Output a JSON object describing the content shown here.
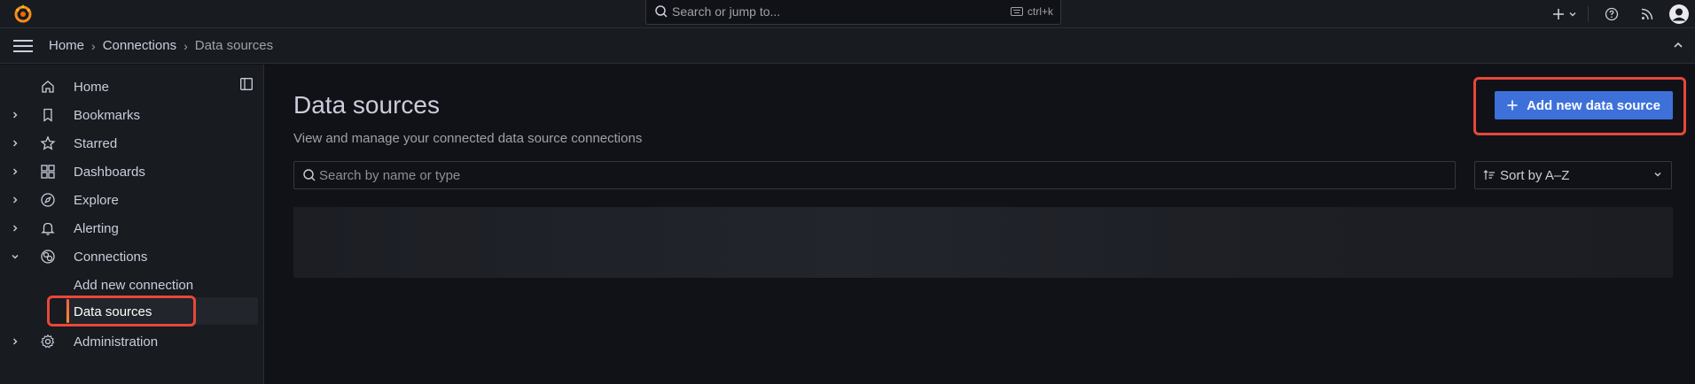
{
  "topbar": {
    "logo": "grafana-logo",
    "search_placeholder": "Search or jump to...",
    "search_shortcut": "ctrl+k",
    "icons": [
      "plus-icon",
      "chevron-down-icon",
      "help-icon",
      "rss-icon",
      "avatar"
    ]
  },
  "breadcrumb": {
    "items": [
      "Home",
      "Connections",
      "Data sources"
    ],
    "separator": "›"
  },
  "sidebar": {
    "items": [
      {
        "label": "Home",
        "icon": "home-icon"
      },
      {
        "label": "Bookmarks",
        "icon": "bookmark-icon"
      },
      {
        "label": "Starred",
        "icon": "star-icon"
      },
      {
        "label": "Dashboards",
        "icon": "apps-icon"
      },
      {
        "label": "Explore",
        "icon": "compass-icon"
      },
      {
        "label": "Alerting",
        "icon": "bell-icon"
      },
      {
        "label": "Connections",
        "icon": "connections-icon"
      },
      {
        "label": "Add new connection",
        "icon": ""
      },
      {
        "label": "Data sources",
        "icon": ""
      },
      {
        "label": "Administration",
        "icon": "cog-icon"
      }
    ],
    "active_item": "Data sources"
  },
  "main": {
    "title": "Data sources",
    "subtitle": "View and manage your connected data source connections",
    "add_button_label": "Add new data source",
    "search_placeholder": "Search by name or type",
    "sort_value": "Sort by A–Z"
  },
  "colors": {
    "accent_blue": "#3d71d9",
    "highlight_red": "#e8473a",
    "active_bar": "#f55f3e",
    "background": "#111217",
    "panel": "#181b1f"
  }
}
